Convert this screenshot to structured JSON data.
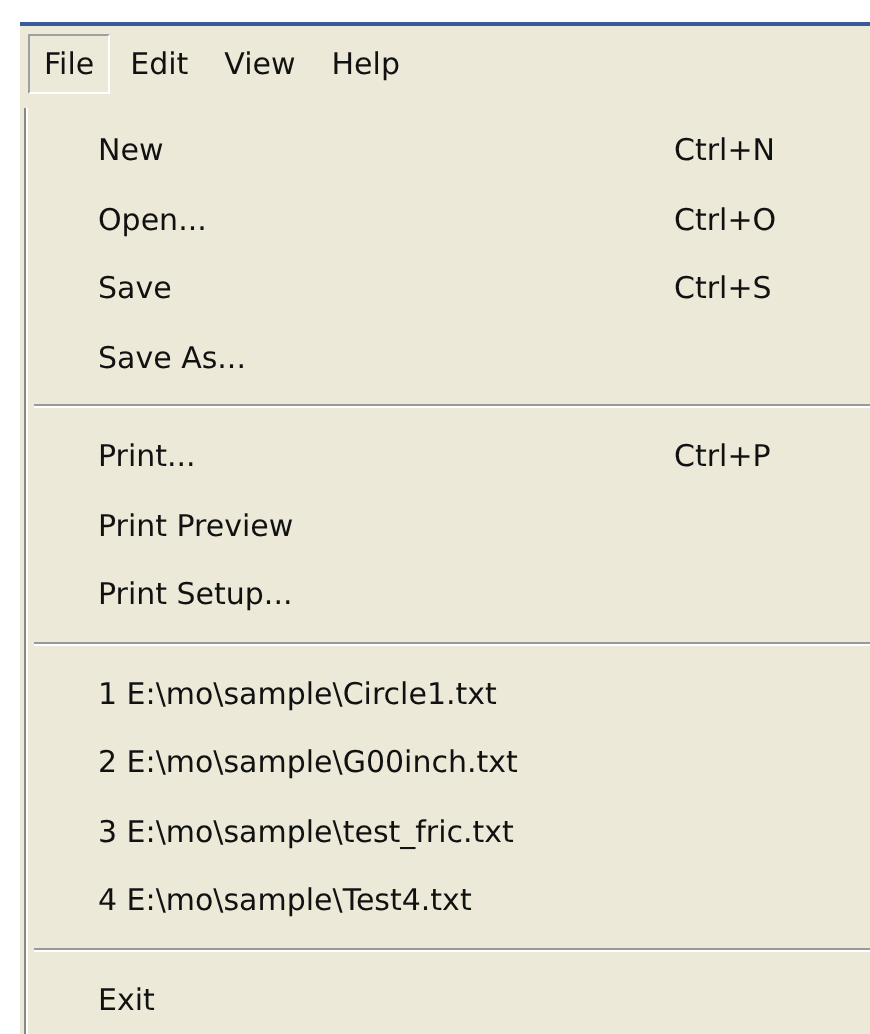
{
  "menubar": [
    {
      "label": "File",
      "selected": true
    },
    {
      "label": "Edit",
      "selected": false
    },
    {
      "label": "View",
      "selected": false
    },
    {
      "label": "Help",
      "selected": false
    }
  ],
  "menu": [
    {
      "kind": "command",
      "label": "New",
      "shortcut": "Ctrl+N"
    },
    {
      "kind": "command",
      "label": "Open...",
      "shortcut": "Ctrl+O"
    },
    {
      "kind": "command",
      "label": "Save",
      "shortcut": "Ctrl+S"
    },
    {
      "kind": "command",
      "label": "Save As..."
    },
    {
      "kind": "separator"
    },
    {
      "kind": "command",
      "label": "Print...",
      "shortcut": "Ctrl+P"
    },
    {
      "kind": "command",
      "label": "Print Preview"
    },
    {
      "kind": "command",
      "label": "Print Setup..."
    },
    {
      "kind": "separator"
    },
    {
      "kind": "command",
      "label": "1 E:\\mo\\sample\\Circle1.txt"
    },
    {
      "kind": "command",
      "label": "2 E:\\mo\\sample\\G00inch.txt"
    },
    {
      "kind": "command",
      "label": "3 E:\\mo\\sample\\test_fric.txt"
    },
    {
      "kind": "command",
      "label": "4 E:\\mo\\sample\\Test4.txt"
    },
    {
      "kind": "separator"
    },
    {
      "kind": "command",
      "label": "Exit"
    }
  ]
}
